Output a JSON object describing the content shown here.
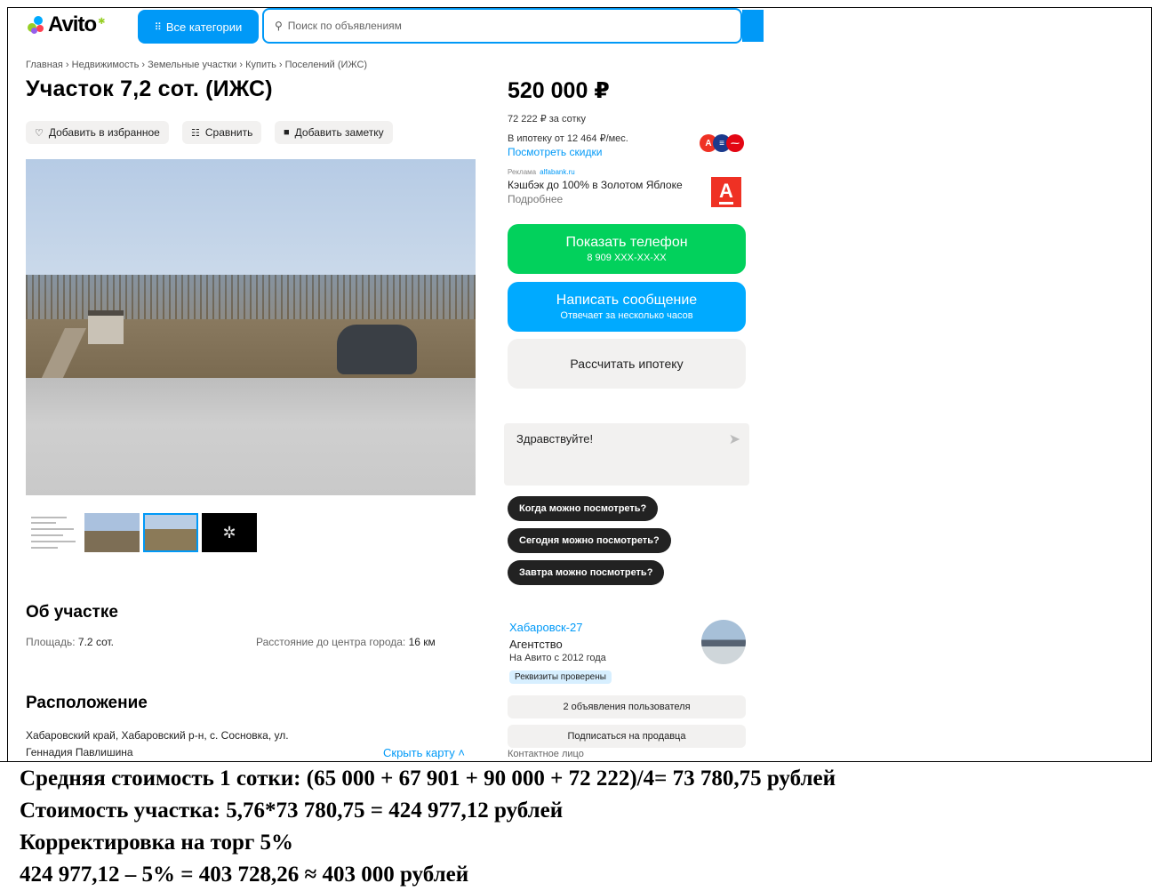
{
  "header": {
    "logo_text": "Avito",
    "categories_label": "Все категории",
    "search_placeholder": "Поиск по объявлениям"
  },
  "breadcrumb": "Главная › Недвижимость › Земельные участки › Купить › Поселений (ИЖС)",
  "listing": {
    "title": "Участок 7,2 сот. (ИЖС)",
    "actions": {
      "favorite": "Добавить в избранное",
      "compare": "Сравнить",
      "note": "Добавить заметку"
    },
    "about": {
      "heading": "Об участке",
      "area_label": "Площадь:",
      "area_value": "7.2 сот.",
      "distance_label": "Расстояние до центра города:",
      "distance_value": "16 км"
    },
    "location": {
      "heading": "Расположение",
      "address_line1": "Хабаровский край, Хабаровский р-н, с. Сосновка, ул.",
      "address_line2": "Геннадия Павлишина",
      "hide_map": "Скрыть карту ˄"
    }
  },
  "sidebar": {
    "price": "520 000 ₽",
    "price_per_unit": "72 222 ₽ за сотку",
    "mortgage_text": "В ипотеку от 12 464 ₽/мес.",
    "discounts_link": "Посмотреть скидки",
    "ad": {
      "label": "Реклама",
      "domain": "alfabank.ru",
      "text": "Кэшбэк до 100% в Золотом Яблоке",
      "more": "Подробнее",
      "logo_letter": "А"
    },
    "phone_button": {
      "label": "Показать телефон",
      "sub": "8 909 XXX-XX-XX"
    },
    "message_button": {
      "label": "Написать сообщение",
      "sub": "Отвечает за несколько часов"
    },
    "mortgage_button": "Рассчитать ипотеку",
    "chat_text": "Здравствуйте!",
    "quick_replies": [
      "Когда можно посмотреть?",
      "Сегодня можно посмотреть?",
      "Завтра можно посмотреть?"
    ],
    "seller": {
      "name": "Хабаровск-27",
      "type": "Агентство",
      "since": "На Авито с 2012 года",
      "verified": "Реквизиты проверены",
      "listings_button": "2 объявления пользователя",
      "subscribe_button": "Подписаться на продавца",
      "contact": "Контактное лицо"
    }
  },
  "calculation": {
    "line1": "Средняя стоимость 1 сотки: (65 000 + 67 901 + 90 000 + 72 222)/4= 73 780,75 рублей",
    "line2": "Стоимость участка: 5,76*73 780,75 = 424 977,12 рублей",
    "line3": "Корректировка на торг 5%",
    "line4": "424 977,12 – 5% = 403 728,26 ≈ 403 000 рублей"
  },
  "colors": {
    "accent_blue": "#0099f7",
    "phone_green": "#02d15c",
    "message_blue": "#00aaff",
    "alfa_red": "#ef3124"
  }
}
